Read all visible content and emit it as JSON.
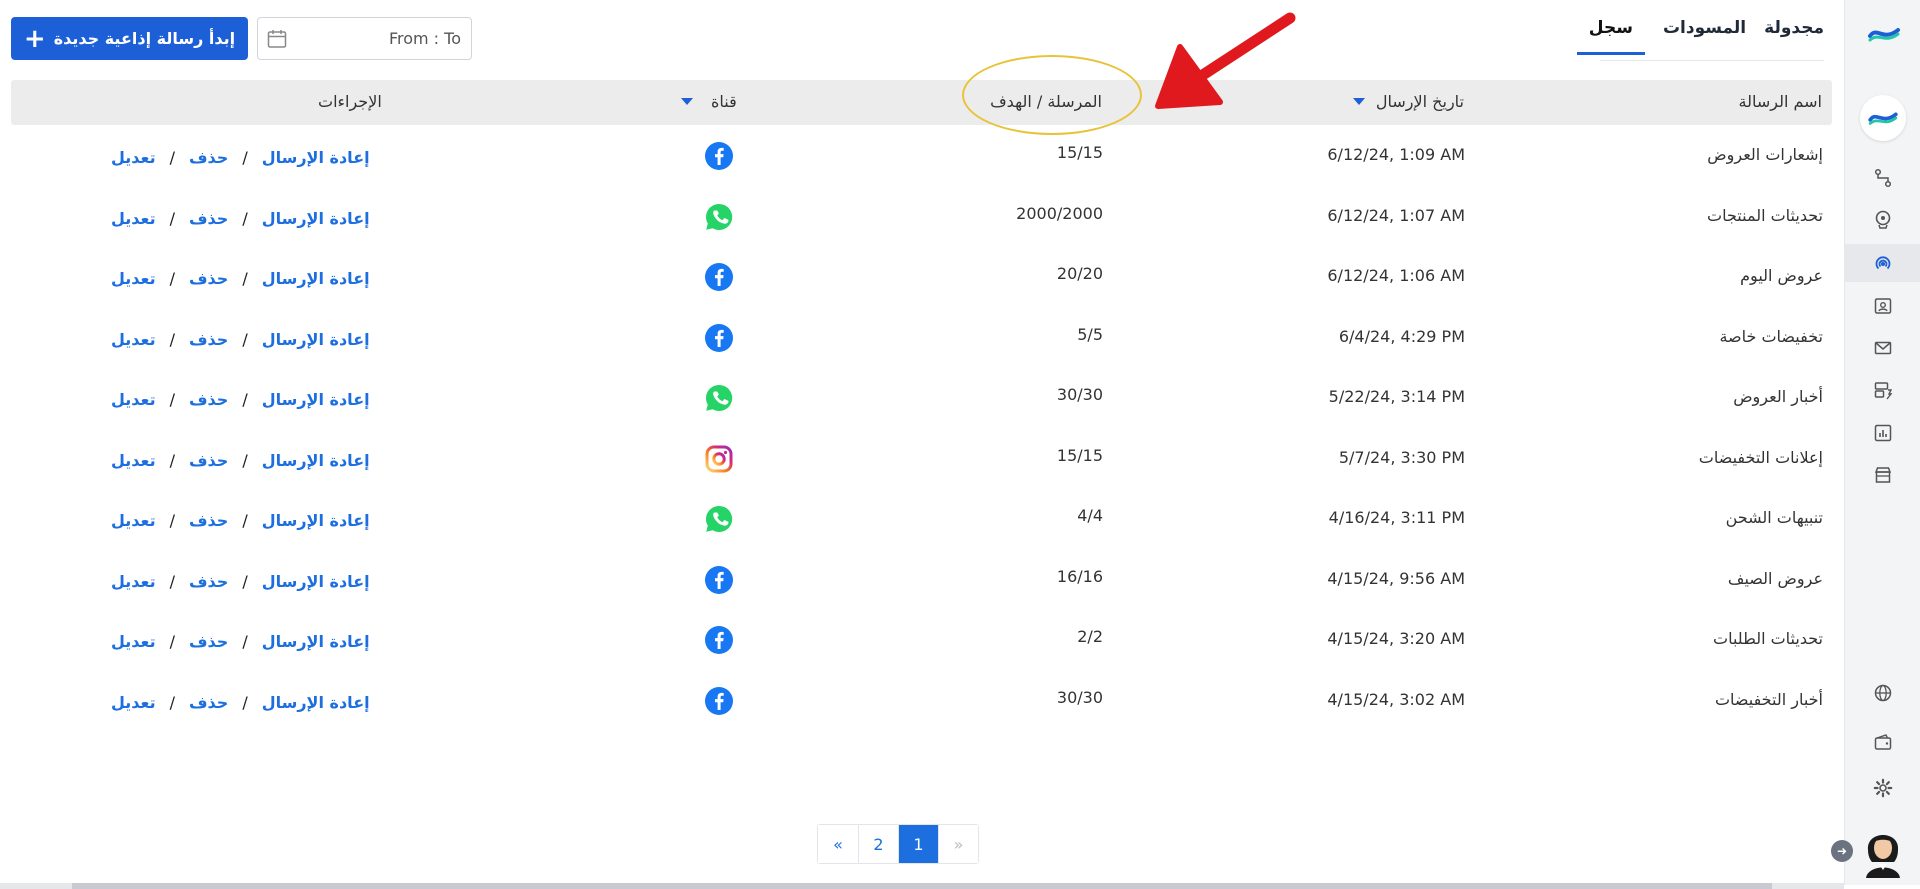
{
  "tabs": [
    {
      "label": "مجدولة"
    },
    {
      "label": "المسودات"
    },
    {
      "label": "سجل"
    }
  ],
  "toolbar": {
    "new_broadcast_label": "إبدأ رسالة إذاعية جديدة",
    "date_range_placeholder": "From : To"
  },
  "table": {
    "headers": {
      "name": "اسم الرسالة",
      "date": "تاريخ الإرسال",
      "sent": "المرسلة / الهدف",
      "channel": "قناة",
      "actions": "الإجراءات"
    },
    "actions": {
      "edit": "تعديل",
      "delete": "حذف",
      "resend": "إعادة الإرسال",
      "separator": "/"
    },
    "rows": [
      {
        "name": "إشعارات العروض",
        "date": "6/12/24, 1:09 AM",
        "sent": "15/15",
        "channel": "facebook"
      },
      {
        "name": "تحديثات المنتجات",
        "date": "6/12/24, 1:07 AM",
        "sent": "2000/2000",
        "channel": "whatsapp"
      },
      {
        "name": "عروض اليوم",
        "date": "6/12/24, 1:06 AM",
        "sent": "20/20",
        "channel": "facebook"
      },
      {
        "name": "تخفيضات خاصة",
        "date": "6/4/24, 4:29 PM",
        "sent": "5/5",
        "channel": "facebook"
      },
      {
        "name": "أخبار العروض",
        "date": "5/22/24, 3:14 PM",
        "sent": "30/30",
        "channel": "whatsapp"
      },
      {
        "name": "إعلانات التخفيضات",
        "date": "5/7/24, 3:30 PM",
        "sent": "15/15",
        "channel": "instagram"
      },
      {
        "name": "تنبيهات الشحن",
        "date": "4/16/24, 3:11 PM",
        "sent": "4/4",
        "channel": "whatsapp"
      },
      {
        "name": "عروض الصيف",
        "date": "4/15/24, 9:56 AM",
        "sent": "16/16",
        "channel": "facebook"
      },
      {
        "name": "تحديثات الطلبات",
        "date": "4/15/24, 3:20 AM",
        "sent": "2/2",
        "channel": "facebook"
      },
      {
        "name": "أخبار التخفيضات",
        "date": "4/15/24, 3:02 AM",
        "sent": "30/30",
        "channel": "facebook"
      }
    ]
  },
  "pagination": {
    "prev_label": "«",
    "next_label": "»",
    "pages": [
      "1",
      "2"
    ],
    "current": "1"
  },
  "colors": {
    "accent": "#1d5fd6",
    "link": "#1d6fe0",
    "facebook": "#1877f2",
    "whatsapp": "#25d366",
    "annotation_circle": "#e8c237",
    "annotation_arrow": "#e0191e"
  },
  "sidebar": {
    "icons": [
      "logo-icon",
      "broadcast-logo-icon",
      "flow-icon",
      "bot-icon",
      "broadcast-icon",
      "contacts-icon",
      "mail-icon",
      "templates-icon",
      "analytics-icon",
      "store-icon",
      "globe-icon",
      "wallet-icon",
      "gear-icon"
    ]
  }
}
